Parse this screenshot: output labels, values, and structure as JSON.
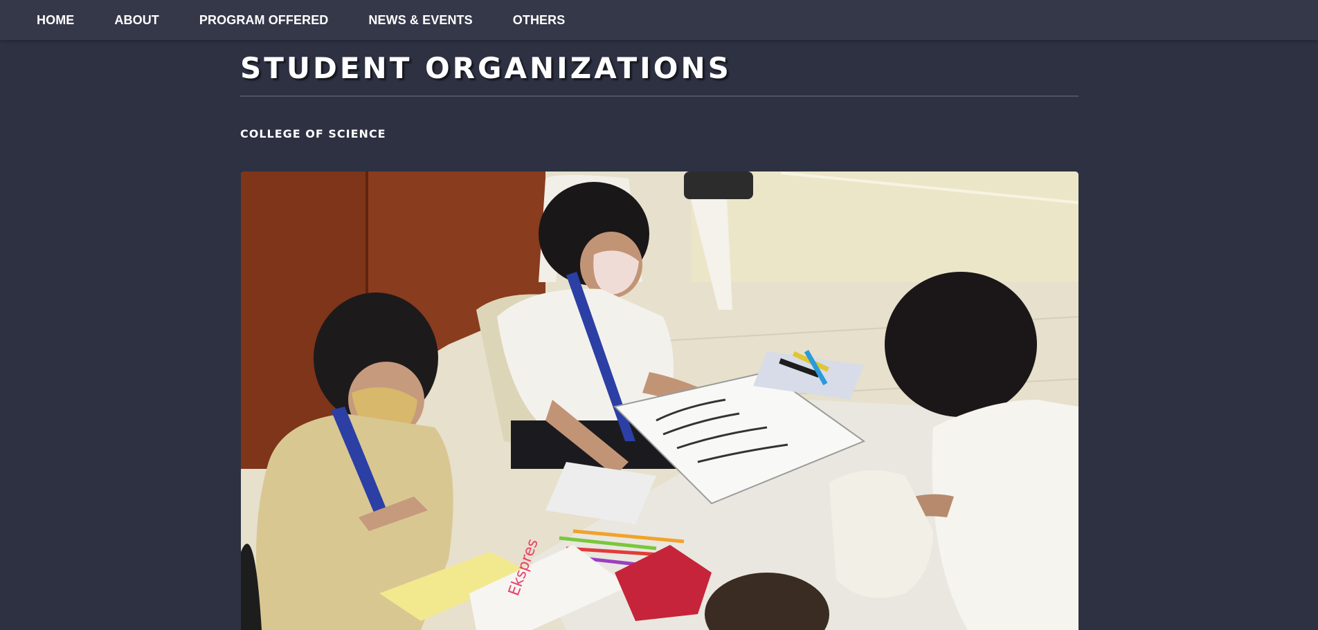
{
  "nav": {
    "items": [
      {
        "label": "HOME"
      },
      {
        "label": "ABOUT"
      },
      {
        "label": "PROGRAM OFFERED"
      },
      {
        "label": "NEWS & EVENTS"
      },
      {
        "label": "OTHERS"
      }
    ]
  },
  "page": {
    "title": "STUDENT ORGANIZATIONS",
    "section_heading": "COLLEGE OF SCIENCE"
  },
  "photo": {
    "description_icon": "photo-students-working"
  },
  "colors": {
    "background": "#2d3142",
    "navbar": "#343849",
    "text": "#ffffff",
    "divider": "#4e5366"
  }
}
